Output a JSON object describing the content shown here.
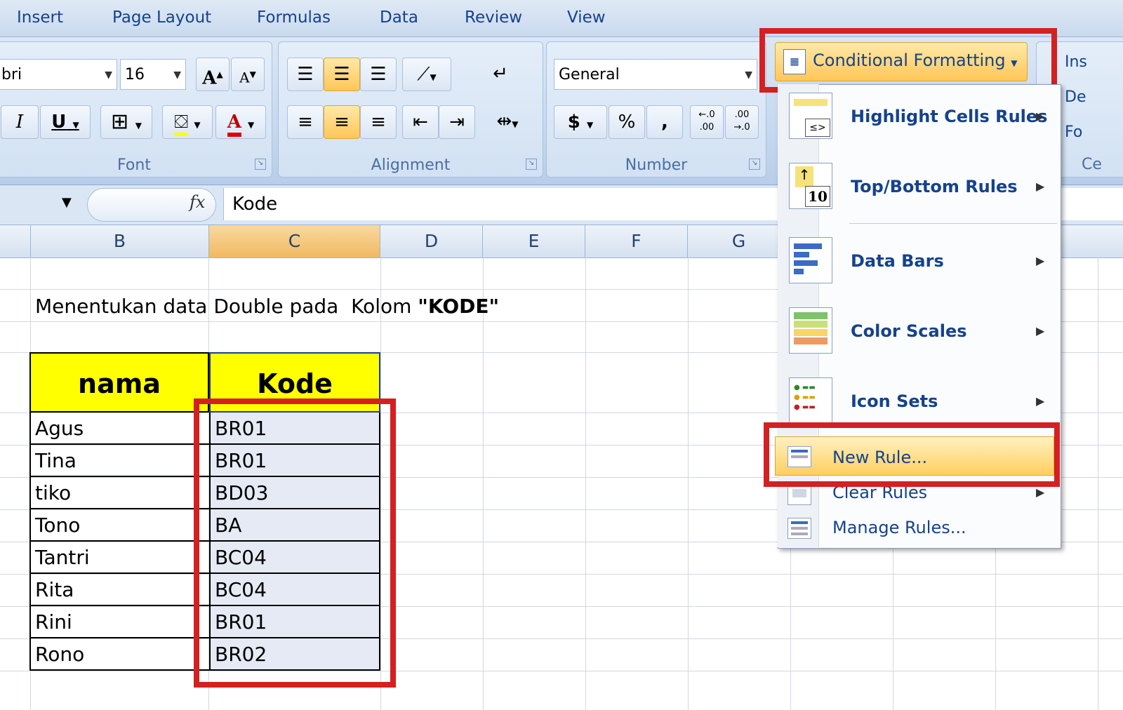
{
  "menu": {
    "tabs": [
      "Insert",
      "Page Layout",
      "Formulas",
      "Data",
      "Review",
      "View"
    ]
  },
  "font_group": {
    "font_name": "bri",
    "font_size": "16",
    "grow_font": "A",
    "shrink_font": "A",
    "italic": "I",
    "underline": "U",
    "font_color_letter": "A",
    "label": "Font"
  },
  "alignment_group": {
    "label": "Alignment"
  },
  "number_group": {
    "format": "General",
    "currency": "$",
    "percent": "%",
    "comma": ",",
    "increase_decimal": "←.0\n.00",
    "decrease_decimal": ".00\n→.0",
    "label": "Number"
  },
  "conditional_formatting": {
    "button_label": "Conditional Formatting",
    "items": [
      {
        "label": "Highlight Cells Rules",
        "icon": "highlight-cells-icon"
      },
      {
        "label": "Top/Bottom Rules",
        "icon": "top-bottom-icon"
      },
      {
        "label": "Data Bars",
        "icon": "data-bars-icon"
      },
      {
        "label": "Color Scales",
        "icon": "color-scales-icon"
      },
      {
        "label": "Icon Sets",
        "icon": "icon-sets-icon"
      },
      {
        "label": "New Rule...",
        "icon": "new-rule-icon"
      },
      {
        "label": "Clear Rules",
        "icon": "clear-rules-icon"
      },
      {
        "label": "Manage Rules...",
        "icon": "manage-rules-icon"
      }
    ],
    "icon_10": "10"
  },
  "cells_group_cut": {
    "insert": "Ins",
    "delete": "De",
    "format": "Fo",
    "label": "Ce"
  },
  "formula_bar": {
    "fx": "fx",
    "value": "Kode"
  },
  "columns": [
    "B",
    "C",
    "D",
    "E",
    "F",
    "G"
  ],
  "sheet": {
    "title_prefix": "Menentukan data Double pada  Kolom ",
    "title_bold": "\"KODE\"",
    "headers": {
      "nama": "nama",
      "kode": "Kode"
    },
    "rows": [
      {
        "nama": "Agus",
        "kode": "BR01"
      },
      {
        "nama": "Tina",
        "kode": "BR01"
      },
      {
        "nama": "tiko",
        "kode": "BD03"
      },
      {
        "nama": "Tono",
        "kode": "BA"
      },
      {
        "nama": "Tantri",
        "kode": "BC04"
      },
      {
        "nama": "Rita",
        "kode": "BC04"
      },
      {
        "nama": "Rini",
        "kode": "BR01"
      },
      {
        "nama": "Rono",
        "kode": "BR02"
      }
    ]
  },
  "colors": {
    "highlight": "#d42020",
    "header_fill": "#ffff00",
    "selection": "#e6eaf4",
    "accent": "#ffc658"
  }
}
